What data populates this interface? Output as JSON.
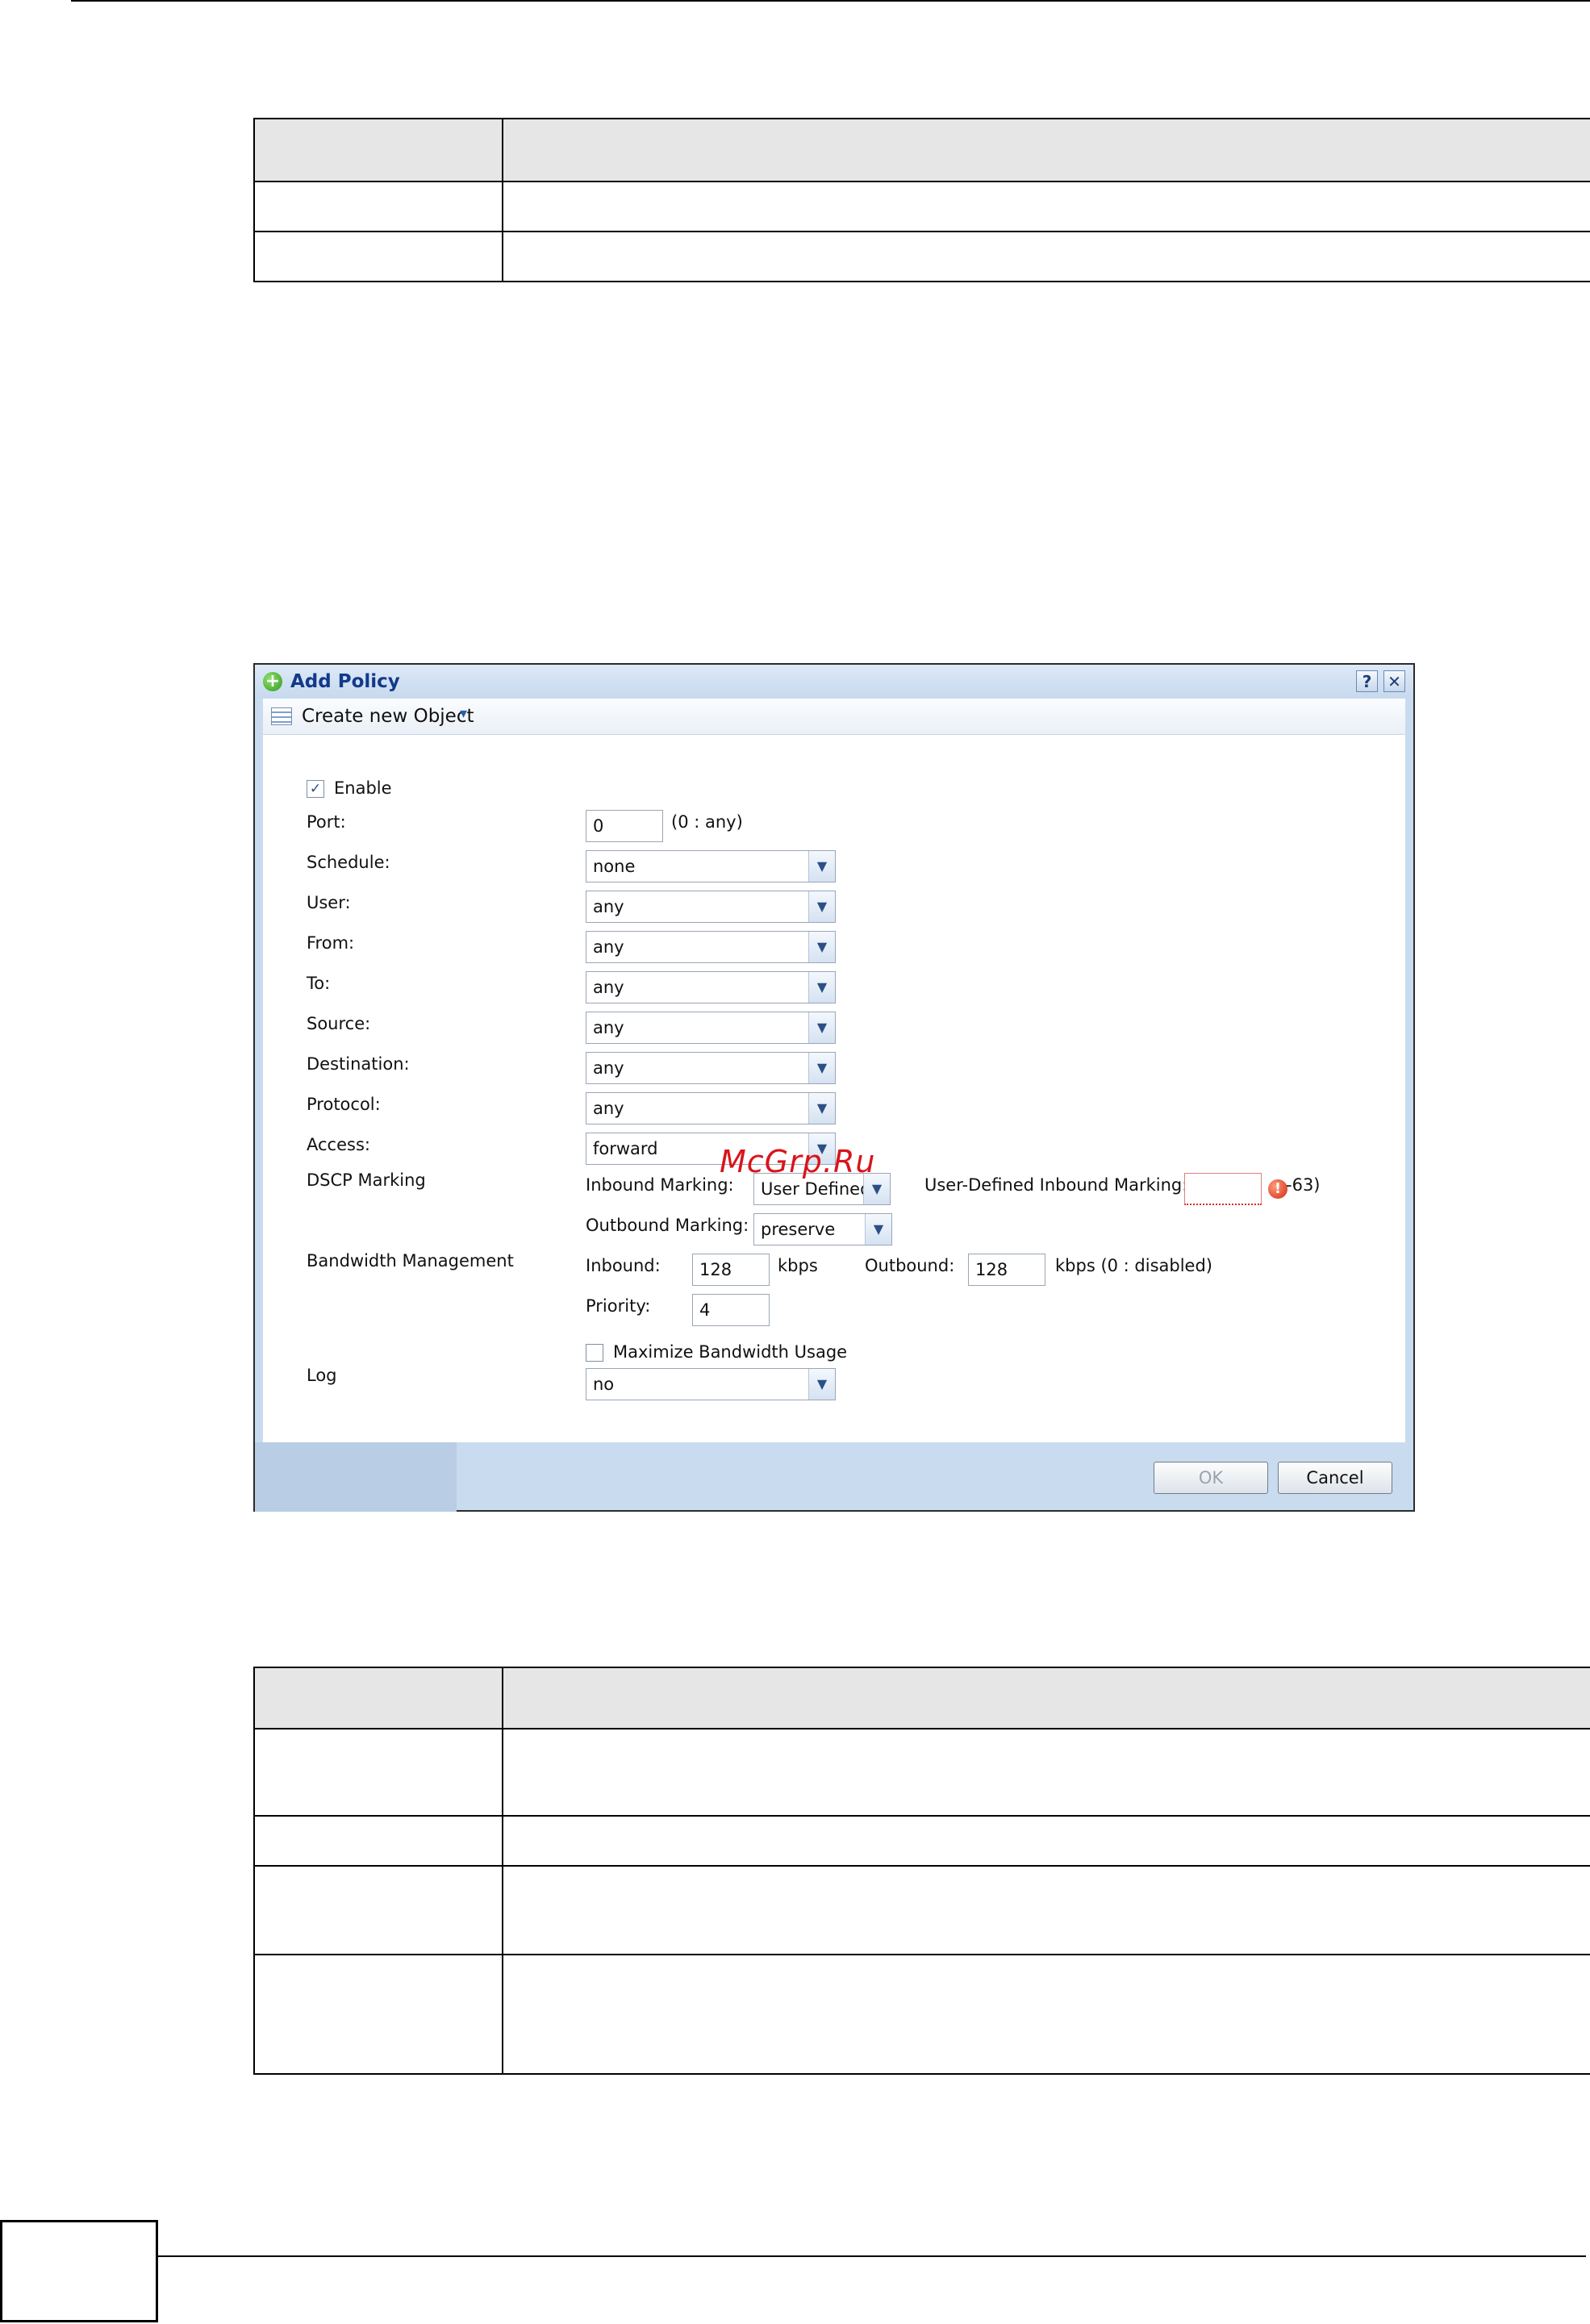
{
  "dialog": {
    "title": "Add Policy",
    "help_label": "?",
    "close_label": "✕",
    "toolbar": {
      "create_new_object": "Create new Object",
      "caret": "▾"
    },
    "form": {
      "enable_label": "Enable",
      "enable_checked": "✓",
      "port_label": "Port:",
      "port_value": "0",
      "port_hint": "(0 : any)",
      "schedule_label": "Schedule:",
      "schedule_value": "none",
      "user_label": "User:",
      "user_value": "any",
      "from_label": "From:",
      "from_value": "any",
      "to_label": "To:",
      "to_value": "any",
      "source_label": "Source:",
      "source_value": "any",
      "destination_label": "Destination:",
      "destination_value": "any",
      "protocol_label": "Protocol:",
      "protocol_value": "any",
      "access_label": "Access:",
      "access_value": "forward",
      "dscp_label": "DSCP Marking",
      "inbound_marking_label": "Inbound Marking:",
      "inbound_marking_value": "User Defined",
      "user_defined_inbound_label": "User-Defined Inbound Marking:",
      "user_defined_inbound_value": "",
      "error_icon_glyph": "!",
      "error_suffix": "-63)",
      "outbound_marking_label": "Outbound Marking:",
      "outbound_marking_value": "preserve",
      "bandwidth_label": "Bandwidth Management",
      "inbound_label": "Inbound:",
      "inbound_value": "128",
      "inbound_unit": "kbps",
      "outbound_label": "Outbound:",
      "outbound_value": "128",
      "outbound_unit": "kbps (0 : disabled)",
      "priority_label": "Priority:",
      "priority_value": "4",
      "maximize_label": "Maximize Bandwidth Usage",
      "log_label": "Log",
      "log_value": "no",
      "dropdown_arrow": "▼"
    },
    "buttons": {
      "ok": "OK",
      "cancel": "Cancel"
    }
  },
  "watermark": "McGrp.Ru",
  "icons": {
    "title": "add-circle-icon",
    "toolbar": "object-list-icon",
    "error": "error-icon"
  }
}
